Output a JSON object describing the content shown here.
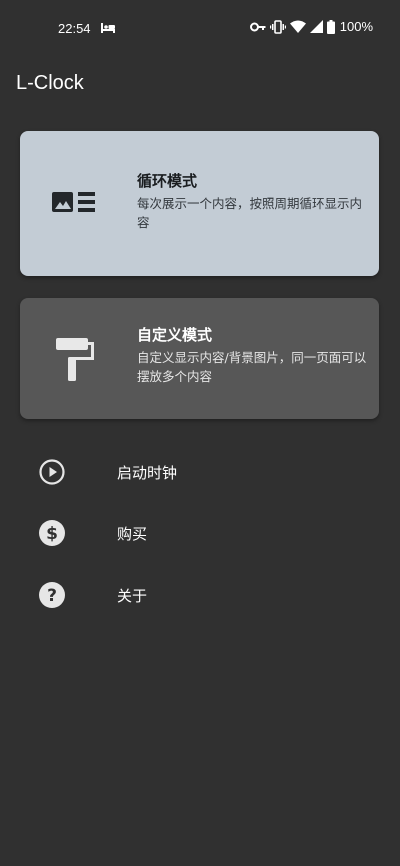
{
  "status_bar": {
    "time": "22:54",
    "battery": "100%",
    "icons": [
      "sleep-icon",
      "key-icon",
      "vibrate-icon",
      "wifi-icon",
      "signal-icon",
      "battery-icon"
    ]
  },
  "app": {
    "title": "L-Clock"
  },
  "cards": {
    "loop": {
      "title": "循环模式",
      "description": "每次展示一个内容，按照周期循环显示内容",
      "icon": "image-list-icon",
      "color": "#c3ccd5"
    },
    "custom": {
      "title": "自定义模式",
      "description": "自定义显示内容/背景图片，同一页面可以摆放多个内容",
      "icon": "paint-roller-icon",
      "color": "#575757"
    }
  },
  "menu": {
    "start": {
      "label": "启动时钟",
      "icon": "play-circle-icon"
    },
    "buy": {
      "label": "购买",
      "icon": "dollar-circle-icon"
    },
    "about": {
      "label": "关于",
      "icon": "help-circle-icon"
    }
  },
  "theme": {
    "background": "#303030"
  }
}
